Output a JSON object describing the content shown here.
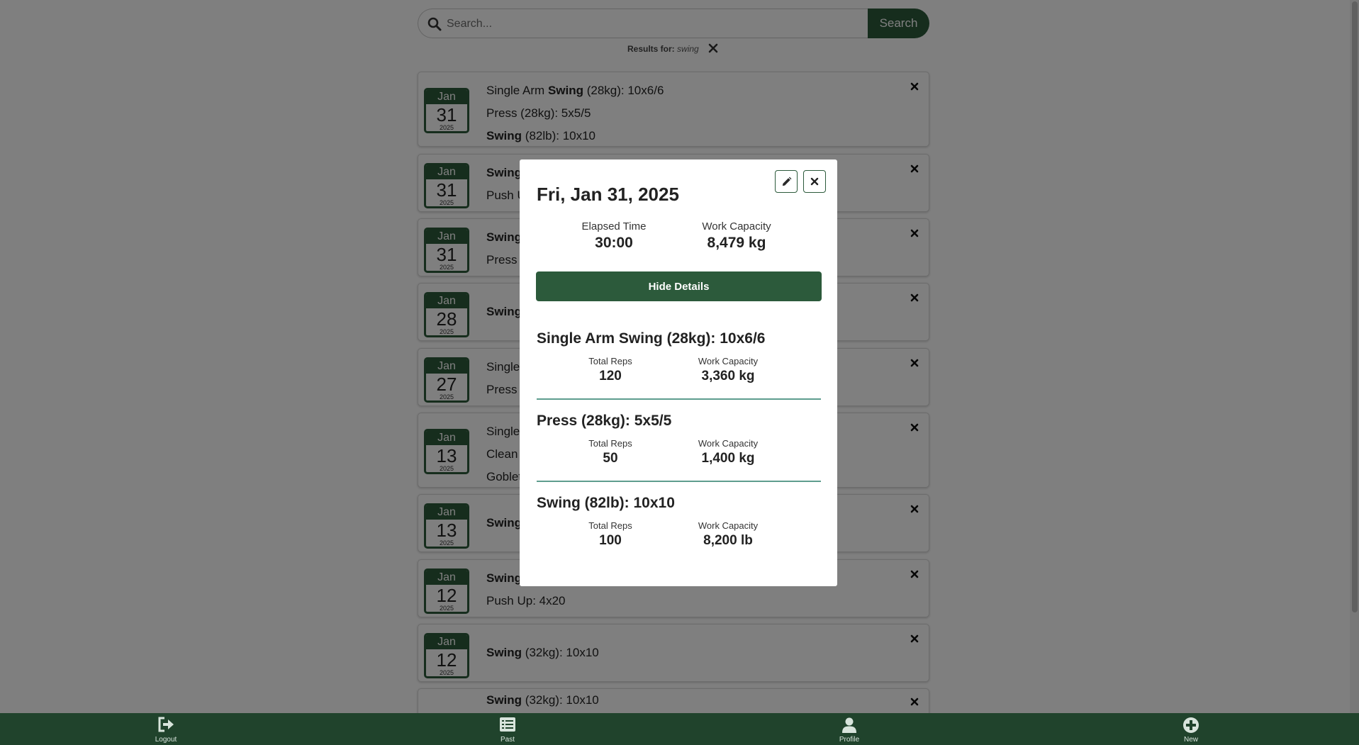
{
  "search": {
    "placeholder": "Search...",
    "button_label": "Search",
    "results_prefix": "Results for:",
    "query": "swing"
  },
  "workouts": [
    {
      "month": "Jan",
      "day": "31",
      "year": "2025",
      "lines": [
        {
          "pre": "Single Arm ",
          "bold": "Swing",
          "post": " (28kg): 10x6/6"
        },
        {
          "pre": "",
          "bold": "",
          "post": "Press (28kg): 5x5/5"
        },
        {
          "pre": "",
          "bold": "Swing",
          "post": " (82lb): 10x10"
        }
      ]
    },
    {
      "month": "Jan",
      "day": "31",
      "year": "2025",
      "lines": [
        {
          "pre": "",
          "bold": "Swing",
          "post": ""
        },
        {
          "pre": "",
          "bold": "",
          "post": "Push U"
        }
      ]
    },
    {
      "month": "Jan",
      "day": "31",
      "year": "2025",
      "lines": [
        {
          "pre": "",
          "bold": "Swing",
          "post": ""
        },
        {
          "pre": "",
          "bold": "",
          "post": "Press"
        }
      ]
    },
    {
      "month": "Jan",
      "day": "28",
      "year": "2025",
      "lines": [
        {
          "pre": "",
          "bold": "Swing",
          "post": ""
        }
      ]
    },
    {
      "month": "Jan",
      "day": "27",
      "year": "2025",
      "lines": [
        {
          "pre": "Single",
          "bold": "",
          "post": ""
        },
        {
          "pre": "",
          "bold": "",
          "post": "Press"
        }
      ]
    },
    {
      "month": "Jan",
      "day": "13",
      "year": "2025",
      "lines": [
        {
          "pre": "Single",
          "bold": "",
          "post": ""
        },
        {
          "pre": "",
          "bold": "",
          "post": "Clean"
        },
        {
          "pre": "",
          "bold": "",
          "post": "Goblet"
        }
      ]
    },
    {
      "month": "Jan",
      "day": "13",
      "year": "2025",
      "lines": [
        {
          "pre": "",
          "bold": "Swing",
          "post": ""
        }
      ]
    },
    {
      "month": "Jan",
      "day": "12",
      "year": "2025",
      "lines": [
        {
          "pre": "",
          "bold": "Swing",
          "post": ""
        },
        {
          "pre": "",
          "bold": "",
          "post": "Push Up: 4x20"
        }
      ]
    },
    {
      "month": "Jan",
      "day": "12",
      "year": "2025",
      "lines": [
        {
          "pre": "",
          "bold": "Swing",
          "post": " (32kg): 10x10"
        }
      ]
    },
    {
      "month": "",
      "day": "",
      "year": "",
      "lines": [
        {
          "pre": "",
          "bold": "Swing",
          "post": " (32kg): 10x10"
        }
      ]
    }
  ],
  "modal": {
    "title": "Fri, Jan 31, 2025",
    "elapsed_label": "Elapsed Time",
    "elapsed_value": "30:00",
    "work_label": "Work Capacity",
    "work_value": "8,479 kg",
    "hide_button": "Hide Details",
    "exercises": [
      {
        "title": "Single Arm Swing (28kg): 10x6/6",
        "reps_label": "Total Reps",
        "reps": "120",
        "work_label": "Work Capacity",
        "work": "3,360 kg"
      },
      {
        "title": "Press (28kg): 5x5/5",
        "reps_label": "Total Reps",
        "reps": "50",
        "work_label": "Work Capacity",
        "work": "1,400 kg"
      },
      {
        "title": "Swing (82lb): 10x10",
        "reps_label": "Total Reps",
        "reps": "100",
        "work_label": "Work Capacity",
        "work": "8,200 lb"
      }
    ]
  },
  "nav": {
    "logout": "Logout",
    "past": "Past",
    "profile": "Profile",
    "new": "New"
  },
  "colors": {
    "brand_green": "#2c5a3b",
    "nav_green": "#20432c",
    "divider_teal": "#5e9d8e"
  },
  "icons": {
    "search": "search-icon",
    "clear": "close-icon",
    "delete": "close-icon",
    "edit": "pencil-icon",
    "close": "close-icon",
    "logout": "logout-icon",
    "past": "list-icon",
    "profile": "user-icon",
    "new": "plus-circle-icon"
  }
}
